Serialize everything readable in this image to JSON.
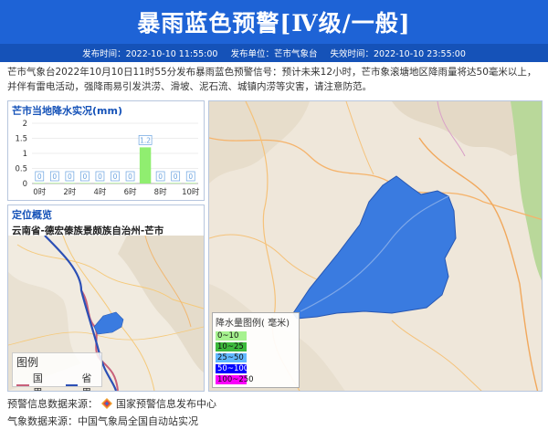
{
  "header": {
    "title": "暴雨蓝色预警[Ⅳ级/一般]",
    "publish_time": "发布时间：2022-10-10 11:55:00",
    "publisher": "发布单位：芒市气象台",
    "expire_time": "失效时间：2022-10-10 23:55:00"
  },
  "description": "芒市气象台2022年10月10日11时55分发布暴雨蓝色预警信号：预计未来12小时，芒市象滚塘地区降雨量将达50毫米以上，并伴有雷电活动，强降雨易引发洪涝、滑坡、泥石流、城镇内涝等灾害，请注意防范。",
  "rain_panel": {
    "title": "芒市当地降水实况(mm)"
  },
  "chart_data": {
    "type": "bar",
    "title": "芒市当地降水实况(mm)",
    "categories": [
      "0时",
      "1时",
      "2时",
      "3时",
      "4时",
      "5时",
      "6时",
      "7时",
      "8时",
      "9时",
      "10时"
    ],
    "x_tick_labels": [
      "0时",
      "2时",
      "4时",
      "6时",
      "8时",
      "10时"
    ],
    "values": [
      0,
      0,
      0,
      0,
      0,
      0,
      0,
      1.2,
      0,
      0,
      0
    ],
    "data_labels": [
      "0",
      "0",
      "0",
      "0",
      "0",
      "0",
      "0",
      "1.2",
      "0",
      "0",
      "0"
    ],
    "ylim": [
      0,
      2
    ],
    "y_ticks": [
      "0",
      "0.5",
      "1",
      "1.5",
      "2"
    ],
    "bar_color": "#90ee70",
    "label_color": "#6aa3e0",
    "grid": true
  },
  "location": {
    "title": "定位概览",
    "region": "云南省-德宏傣族景颇族自治州-芒市",
    "legend_title": "图例",
    "legend_items": [
      {
        "label": "国界",
        "color": "#c8607a"
      },
      {
        "label": "省界",
        "color": "#2b4fb5"
      }
    ]
  },
  "main_map": {
    "warning_area_color": "#3a7be0",
    "rain_legend_title": "降水量图例( 毫米)",
    "rain_legend": [
      {
        "label": "0~10",
        "color": "#a6f28f"
      },
      {
        "label": "10~25",
        "color": "#3dba3d"
      },
      {
        "label": "25~50",
        "color": "#61b8ff"
      },
      {
        "label": "50~100",
        "color": "#0000fe"
      },
      {
        "label": "100~250",
        "color": "#fa00fa"
      }
    ]
  },
  "footer": {
    "warning_source": "预警信息数据来源：",
    "warning_source_name": "国家预警信息发布中心",
    "weather_source": "气象数据来源：中国气象局全国自动站实况"
  }
}
